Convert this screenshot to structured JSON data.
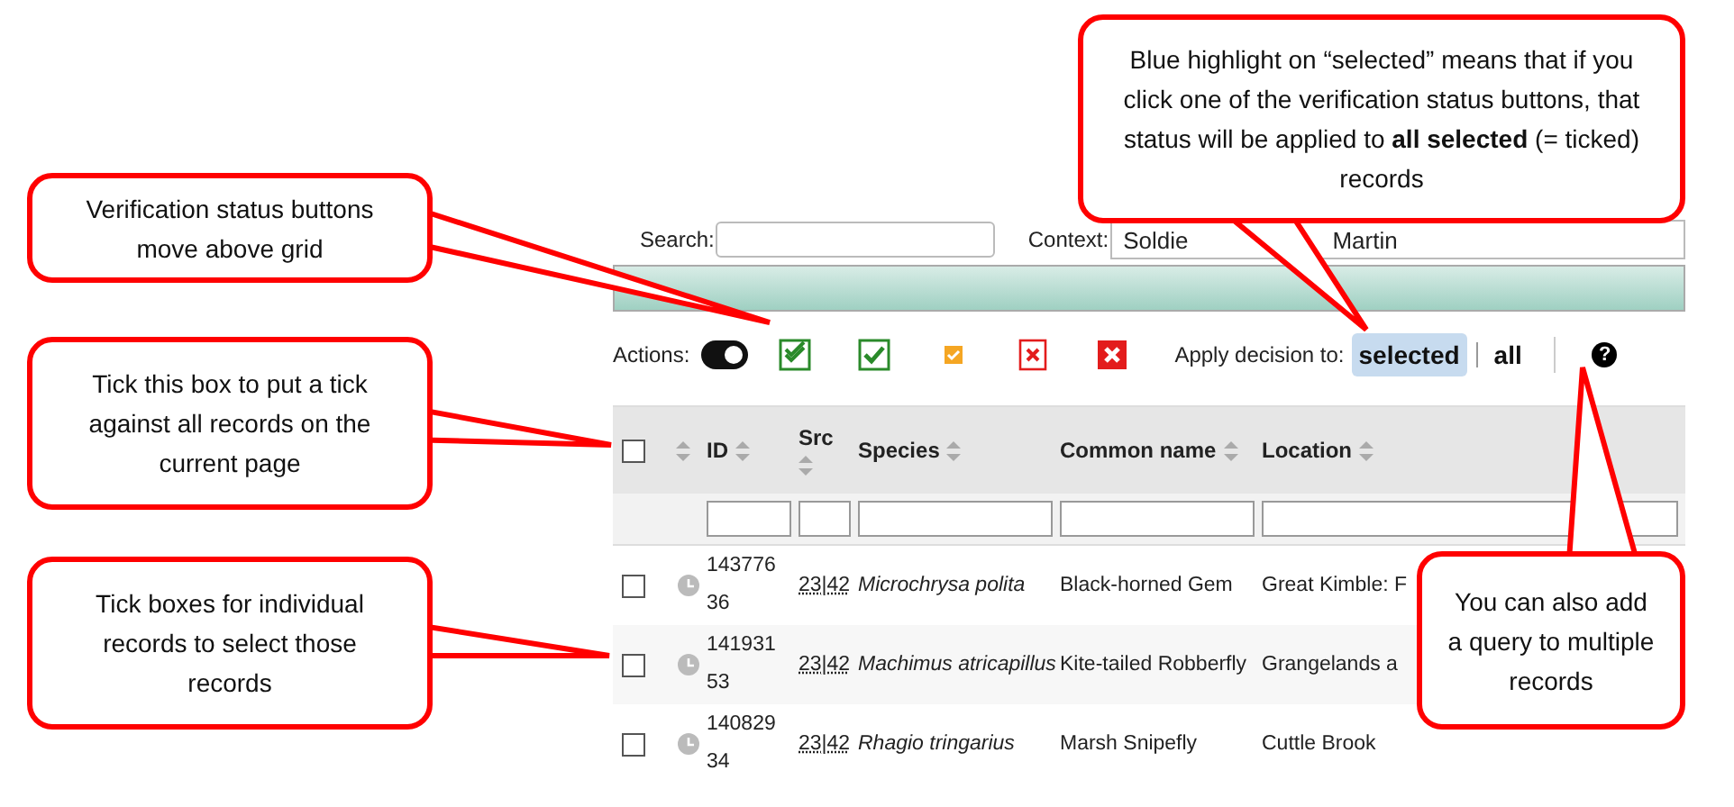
{
  "search": {
    "label": "Search:"
  },
  "context": {
    "label": "Context:",
    "value_parts": [
      "Soldie",
      "Martin"
    ]
  },
  "actions": {
    "label": "Actions:",
    "toggle": {
      "on": true
    },
    "buttons": [
      {
        "kind": "double-tick"
      },
      {
        "kind": "tick"
      },
      {
        "kind": "query"
      },
      {
        "kind": "cross-outline"
      },
      {
        "kind": "cross"
      }
    ],
    "apply_label": "Apply decision to:",
    "apply_options": [
      {
        "label": "selected",
        "selected": true
      },
      {
        "label": "all",
        "selected": false
      }
    ],
    "help": "?"
  },
  "table": {
    "select_all": {
      "checked": false
    },
    "columns": [
      "ID",
      "Src",
      "Species",
      "Common name",
      "Location"
    ],
    "rows": [
      {
        "checked": false,
        "id": "143776\n36",
        "src": "23|42",
        "species": "Microchrysa polita",
        "common_name": "Black-horned Gem",
        "location": "Great Kimble: F"
      },
      {
        "checked": false,
        "id": "141931\n53",
        "src": "23|42",
        "species": "Machimus atricapillus",
        "common_name": "Kite-tailed Robberfly",
        "location": "Grangelands a"
      },
      {
        "checked": false,
        "id": "140829\n34",
        "src": "23|42",
        "species": "Rhagio tringarius",
        "common_name": "Marsh Snipefly",
        "location": "Cuttle Brook"
      }
    ]
  },
  "callouts": [
    {
      "text": "Verification status buttons move above grid"
    },
    {
      "text": "Tick this box to put a tick against all records on the current page"
    },
    {
      "text": "Tick boxes for individual records to select those records"
    },
    {
      "text": "Blue highlight on “selected” means that if you click one of the verification status buttons, that status will be applied to **all selected** (= ticked) records"
    },
    {
      "text": "You can also add a query to multiple records"
    }
  ]
}
